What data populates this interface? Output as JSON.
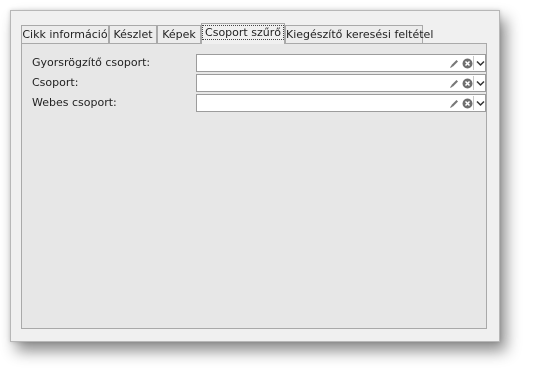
{
  "tabs": [
    {
      "label": "Cikk információ",
      "active": false
    },
    {
      "label": "Készlet",
      "active": false
    },
    {
      "label": "Képek",
      "active": false
    },
    {
      "label": "Csoport szűrő",
      "active": true
    },
    {
      "label": "Kiegészítő keresési feltétel",
      "active": false
    }
  ],
  "fields": [
    {
      "label": "Gyorsrögzítő csoport:",
      "value": ""
    },
    {
      "label": "Csoport:",
      "value": ""
    },
    {
      "label": "Webes csoport:",
      "value": ""
    }
  ],
  "icons": {
    "edit": "pencil-icon",
    "clear": "clear-circle-icon",
    "dropdown": "chevron-down-icon"
  }
}
